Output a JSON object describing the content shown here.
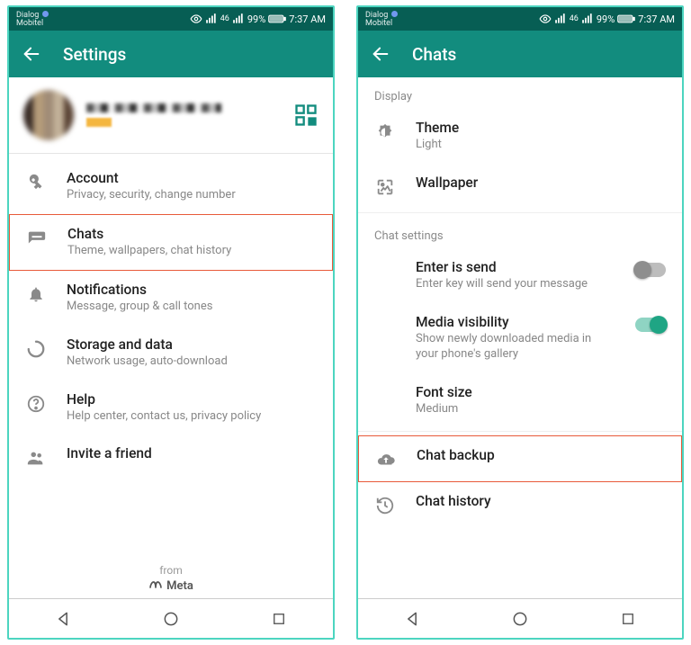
{
  "status": {
    "carrier_line1": "Dialog",
    "carrier_line2": "Mobitel",
    "battery": "99%",
    "time": "7:37 AM",
    "net": "46"
  },
  "screen1": {
    "title": "Settings",
    "items": {
      "account": {
        "title": "Account",
        "sub": "Privacy, security, change number"
      },
      "chats": {
        "title": "Chats",
        "sub": "Theme, wallpapers, chat history"
      },
      "notif": {
        "title": "Notifications",
        "sub": "Message, group & call tones"
      },
      "storage": {
        "title": "Storage and data",
        "sub": "Network usage, auto-download"
      },
      "help": {
        "title": "Help",
        "sub": "Help center, contact us, privacy policy"
      },
      "invite": {
        "title": "Invite a friend"
      }
    },
    "footer": {
      "from": "from",
      "brand": "Meta"
    }
  },
  "screen2": {
    "title": "Chats",
    "section_display": "Display",
    "section_chatset": "Chat settings",
    "theme": {
      "title": "Theme",
      "sub": "Light"
    },
    "wallpaper": {
      "title": "Wallpaper"
    },
    "enter": {
      "title": "Enter is send",
      "sub": "Enter key will send your message"
    },
    "media": {
      "title": "Media visibility",
      "sub": "Show newly downloaded media in your phone's gallery"
    },
    "font": {
      "title": "Font size",
      "sub": "Medium"
    },
    "backup": {
      "title": "Chat backup"
    },
    "history": {
      "title": "Chat history"
    }
  }
}
